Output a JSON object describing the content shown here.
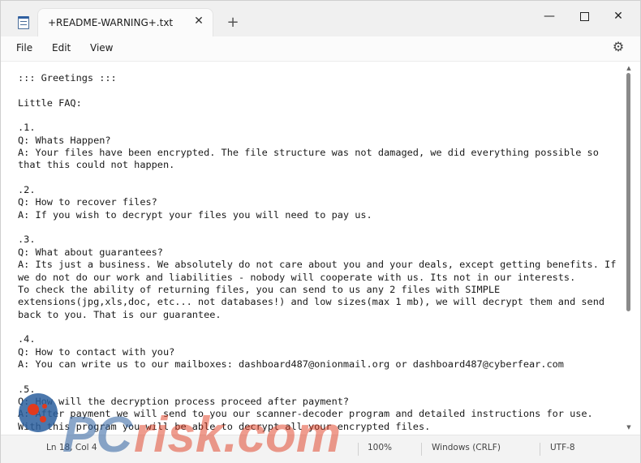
{
  "window": {
    "tab_title": "+README-WARNING+.txt",
    "tab_close": "✕",
    "new_tab": "+",
    "minimize": "—",
    "close": "✕"
  },
  "menu": {
    "file": "File",
    "edit": "Edit",
    "view": "View",
    "settings_icon": "⚙"
  },
  "editor": {
    "lines": [
      "::: Greetings :::",
      "",
      "Little FAQ:",
      "",
      ".1.",
      "Q: Whats Happen?",
      "A: Your files have been encrypted. The file structure was not damaged, we did everything possible so",
      "that this could not happen.",
      "",
      ".2.",
      "Q: How to recover files?",
      "A: If you wish to decrypt your files you will need to pay us.",
      "",
      ".3.",
      "Q: What about guarantees?",
      "A: Its just a business. We absolutely do not care about you and your deals, except getting benefits. If",
      "we do not do our work and liabilities - nobody will cooperate with us. Its not in our interests.",
      "To check the ability of returning files, you can send to us any 2 files with SIMPLE",
      "extensions(jpg,xls,doc, etc... not databases!) and low sizes(max 1 mb), we will decrypt them and send",
      "back to you. That is our guarantee.",
      "",
      ".4.",
      "Q: How to contact with you?",
      "A: You can write us to our mailboxes: dashboard487@onionmail.org or dashboard487@cyberfear.com",
      "",
      ".5.",
      "Q: How will the decryption process proceed after payment?",
      "A: After payment we will send to you our scanner-decoder program and detailed instructions for use.",
      "With this program you will be able to decrypt all your encrypted files."
    ]
  },
  "scrollbar": {
    "up": "▲",
    "down": "▼"
  },
  "status": {
    "position": "Ln 18, Col 4",
    "zoom": "100%",
    "line_ending": "Windows (CRLF)",
    "encoding": "UTF-8"
  },
  "watermark": {
    "text": "PCrisk.com",
    "colors": {
      "blue": "#2c5f9e",
      "red": "#e03a1e"
    }
  }
}
